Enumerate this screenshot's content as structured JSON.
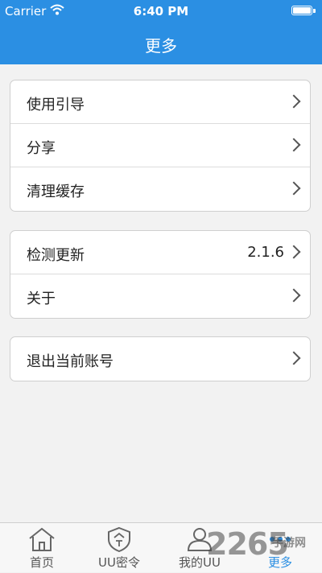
{
  "status_bar": {
    "carrier": "Carrier",
    "time": "6:40 PM"
  },
  "nav": {
    "title": "更多"
  },
  "groups": [
    {
      "items": [
        {
          "label": "使用引导"
        },
        {
          "label": "分享"
        },
        {
          "label": "清理缓存"
        }
      ]
    },
    {
      "items": [
        {
          "label": "检测更新",
          "value": "2.1.6"
        },
        {
          "label": "关于"
        }
      ]
    },
    {
      "items": [
        {
          "label": "退出当前账号"
        }
      ]
    }
  ],
  "tabbar": {
    "tabs": [
      {
        "label": "首页",
        "icon": "home-icon"
      },
      {
        "label": "UU密令",
        "icon": "shield-icon"
      },
      {
        "label": "我的UU",
        "icon": "user-icon"
      },
      {
        "label": "更多",
        "icon": "more-icon",
        "active": true
      }
    ]
  },
  "watermark": {
    "number": "2265",
    "site": "手游网"
  },
  "colors": {
    "accent": "#2b8fe3",
    "background": "#f2f2f2"
  }
}
